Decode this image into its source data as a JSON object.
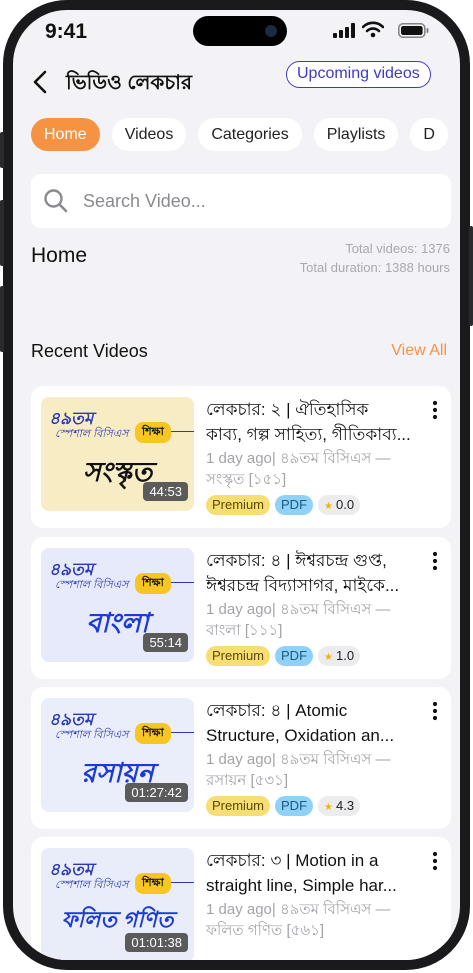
{
  "status_bar": {
    "time": "9:41"
  },
  "header": {
    "title": "ভিডিও লেকচার",
    "upcoming_label": "Upcoming videos"
  },
  "tabs": [
    {
      "label": "Home",
      "active": true
    },
    {
      "label": "Videos",
      "active": false
    },
    {
      "label": "Categories",
      "active": false
    },
    {
      "label": "Playlists",
      "active": false
    },
    {
      "label": "D",
      "active": false
    }
  ],
  "search": {
    "placeholder": "Search Video..."
  },
  "home": {
    "heading": "Home",
    "total_videos": "Total videos: 1376",
    "total_duration": "Total duration: 1388 hours"
  },
  "recent": {
    "heading": "Recent Videos",
    "view_all": "View All",
    "videos": [
      {
        "title_line1": "লেকচার: ২ | ঐতিহাসিক",
        "title_line2": "কাব্য, গল্প সাহিত্য, গীতিকাব্য...",
        "meta_line1": "1 day ago| ৪৯তম বিসিএস —",
        "meta_line2": "সংস্কৃত [১৫১]",
        "thumb_subject": "সংস্কৃত",
        "thumb_badge": "৪৯তম",
        "thumb_special": "স্পেশাল বিসিএস",
        "thumb_edu": "শিক্ষা",
        "duration": "44:53",
        "tag_premium": "Premium",
        "tag_pdf": "PDF",
        "rating": "0.0",
        "thumb_bg": "#f8ecc4",
        "subject_color": "#111111"
      },
      {
        "title_line1": "লেকচার: ৪ | ঈশ্বরচন্দ্র গুপ্ত,",
        "title_line2": "ঈশ্বরচন্দ্র বিদ্যাসাগর, মাইকে...",
        "meta_line1": "1 day ago| ৪৯তম বিসিএস —",
        "meta_line2": "বাংলা [১১১]",
        "thumb_subject": "বাংলা",
        "thumb_badge": "৪৯তম",
        "thumb_special": "স্পেশাল বিসিএস",
        "thumb_edu": "শিক্ষা",
        "duration": "55:14",
        "tag_premium": "Premium",
        "tag_pdf": "PDF",
        "rating": "1.0",
        "thumb_bg": "#e6eafb",
        "subject_color": "#1d3ad6"
      },
      {
        "title_line1": "লেকচার: ৪ | Atomic",
        "title_line2": "Structure, Oxidation an...",
        "meta_line1": "1 day ago| ৪৯তম বিসিএস —",
        "meta_line2": "রসায়ন [৫৩১]",
        "thumb_subject": "রসায়ন",
        "thumb_badge": "৪৯তম",
        "thumb_special": "স্পেশাল বিসিএস",
        "thumb_edu": "শিক্ষা",
        "duration": "01:27:42",
        "tag_premium": "Premium",
        "tag_pdf": "PDF",
        "rating": "4.3",
        "thumb_bg": "#eaeefa",
        "subject_color": "#1d3ad6"
      },
      {
        "title_line1": "লেকচার: ৩ | Motion in a",
        "title_line2": "straight line, Simple har...",
        "meta_line1": "1 day ago| ৪৯তম বিসিএস —",
        "meta_line2": "ফলিত গণিত [৫৬১]",
        "thumb_subject": "ফলিত গণিত",
        "thumb_badge": "৪৯তম",
        "thumb_special": "স্পেশাল বিসিএস",
        "thumb_edu": "শিক্ষা",
        "duration": "01:01:38",
        "tag_premium": "",
        "tag_pdf": "",
        "rating": "",
        "thumb_bg": "#e9edf9",
        "subject_color": "#1d3ad6"
      }
    ]
  },
  "colors": {
    "accent": "#f59343",
    "upcoming_border": "#3d39c9",
    "premium": "#f7de72",
    "pdf": "#8fd1f7"
  },
  "icons": [
    "back-arrow-icon",
    "search-icon",
    "kebab-menu-icon",
    "star-icon",
    "signal-icon",
    "wifi-icon",
    "battery-icon"
  ]
}
